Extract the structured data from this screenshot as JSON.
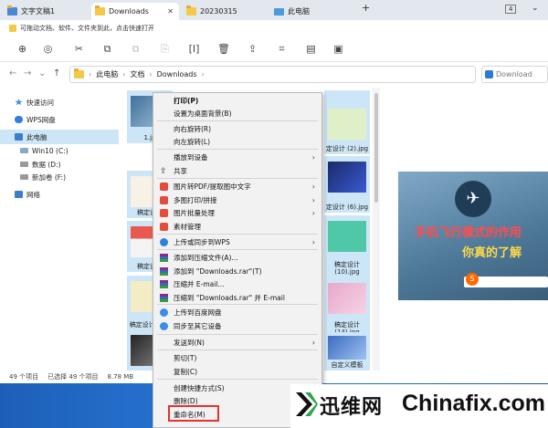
{
  "tabs": [
    {
      "label": "文字文稿1",
      "icon": "document-icon",
      "active": false
    },
    {
      "label": "Downloads",
      "icon": "folder-icon",
      "active": true
    },
    {
      "label": "20230315",
      "icon": "folder-icon",
      "active": false
    },
    {
      "label": "此电脑",
      "icon": "computer-icon",
      "active": false
    }
  ],
  "tab_count": "4",
  "ribbon_hint": "可拖动文档、软件、文件夹到此，点击快速打开",
  "breadcrumb": [
    "此电脑",
    "文档",
    "Downloads"
  ],
  "search_placeholder": "Download",
  "sidebar": [
    {
      "label": "快速访问",
      "icon": "star-icon"
    },
    {
      "label": "WPS网盘",
      "icon": "cloud-icon"
    },
    {
      "label": "此电脑",
      "icon": "computer-icon"
    },
    {
      "label": "Win10 (C:)",
      "icon": "drive-icon"
    },
    {
      "label": "数据 (D:)",
      "icon": "drive-icon"
    },
    {
      "label": "新加卷 (F:)",
      "icon": "drive-icon"
    },
    {
      "label": "网络",
      "icon": "network-icon"
    }
  ],
  "files": {
    "col1": [
      "1.jp",
      "稿定设计",
      "稿定设计",
      "稿定设计 (11)",
      "稿定设计",
      "稿定设计"
    ],
    "col4": [
      "定设计 (2).jpg",
      "定设计 (6).jpg",
      "稿定设计 (10).jpg",
      "稿定设计 (14).jpg",
      "自定义模板"
    ]
  },
  "status": {
    "count": "49 个项目",
    "selected": "已选择 49 个项目",
    "size": "8.78 MB"
  },
  "context_menu": [
    {
      "label": "打印(P)",
      "icon": "",
      "submenu": false,
      "bold": true
    },
    {
      "label": "设置为桌面背景(B)",
      "icon": "",
      "submenu": false
    },
    {
      "label": "向右旋转(R)",
      "icon": "",
      "submenu": false
    },
    {
      "label": "向左旋转(L)",
      "icon": "",
      "submenu": false
    },
    {
      "label": "播放到设备",
      "icon": "",
      "submenu": true
    },
    {
      "label": "共享",
      "icon": "share-icon",
      "submenu": false
    },
    {
      "label": "图片转PDF/提取图中文字",
      "icon": "wps-icon",
      "submenu": true
    },
    {
      "label": "多图打印/拼接",
      "icon": "wps-icon",
      "submenu": true
    },
    {
      "label": "图片批量处理",
      "icon": "wps-icon",
      "submenu": true
    },
    {
      "label": "素材管理",
      "icon": "wps-icon",
      "submenu": false
    },
    {
      "label": "上传或同步到WPS",
      "icon": "wps-cloud-icon",
      "submenu": true
    },
    {
      "label": "添加到压缩文件(A)...",
      "icon": "rar-icon",
      "submenu": false
    },
    {
      "label": "添加到 \"Downloads.rar\"(T)",
      "icon": "rar-icon",
      "submenu": false
    },
    {
      "label": "压缩并 E-mail...",
      "icon": "rar-icon",
      "submenu": false
    },
    {
      "label": "压缩到 \"Downloads.rar\" 并 E-mail",
      "icon": "rar-icon",
      "submenu": false
    },
    {
      "label": "上传到百度网盘",
      "icon": "baidu-icon",
      "submenu": false
    },
    {
      "label": "同步至其它设备",
      "icon": "baidu-icon",
      "submenu": false
    },
    {
      "label": "发送到(N)",
      "icon": "",
      "submenu": true
    },
    {
      "label": "剪切(T)",
      "icon": "",
      "submenu": false
    },
    {
      "label": "复制(C)",
      "icon": "",
      "submenu": false
    },
    {
      "label": "创建快捷方式(S)",
      "icon": "",
      "submenu": false
    },
    {
      "label": "删除(D)",
      "icon": "",
      "submenu": false
    },
    {
      "label": "重命名(M)",
      "icon": "",
      "submenu": false
    }
  ],
  "preview": {
    "caption_top": "手机飞行模式的作用",
    "caption_bottom": "你真的了解"
  },
  "watermark": {
    "cn": "迅维网",
    "en": "Chinafix.com"
  },
  "colors": {
    "accent": "#2a7bd6",
    "selection": "#cde6f7",
    "highlight": "#e5322d",
    "wps_red": "#e34b3c"
  }
}
